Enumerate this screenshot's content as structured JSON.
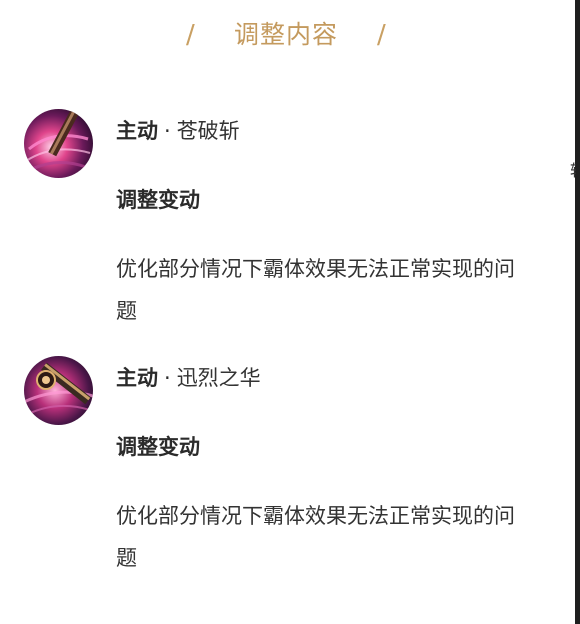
{
  "header": {
    "title": "调整内容",
    "slash_left": "/",
    "slash_right": "/",
    "accent_color": "#c49a5e"
  },
  "skills": [
    {
      "type": "主动",
      "separator": "·",
      "name": "苍破斩",
      "icon": "skill-cangpozhan-icon",
      "change_label": "调整变动",
      "description": "优化部分情况下霸体效果无法正常实现的问题"
    },
    {
      "type": "主动",
      "separator": "·",
      "name": "迅烈之华",
      "icon": "skill-xunliezhihua-icon",
      "change_label": "调整变动",
      "description": "优化部分情况下霸体效果无法正常实现的问题"
    }
  ],
  "edge_glyph": "转"
}
